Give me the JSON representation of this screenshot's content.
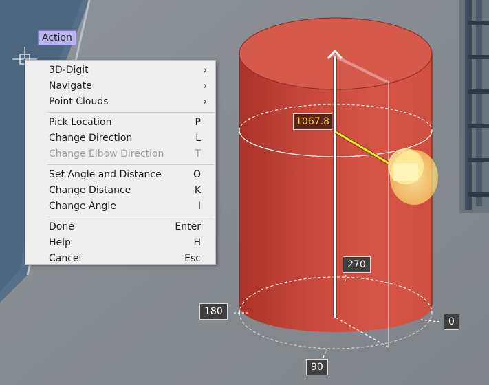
{
  "action_tag": "Action",
  "distance_label": "1067.8",
  "angle_labels": {
    "deg_0": "0",
    "deg_90": "90",
    "deg_180": "180",
    "deg_270": "270"
  },
  "menu": {
    "groups": [
      [
        {
          "label": "3D-Digit",
          "submenu": true,
          "name": "menu-item-3d-digit"
        },
        {
          "label": "Navigate",
          "submenu": true,
          "name": "menu-item-navigate"
        },
        {
          "label": "Point Clouds",
          "submenu": true,
          "name": "menu-item-point-clouds"
        }
      ],
      [
        {
          "label": "Pick Location",
          "key": "P",
          "name": "menu-item-pick-location"
        },
        {
          "label": "Change Direction",
          "key": "L",
          "name": "menu-item-change-direction"
        },
        {
          "label": "Change Elbow Direction",
          "key": "T",
          "disabled": true,
          "name": "menu-item-change-elbow-direction"
        }
      ],
      [
        {
          "label": "Set Angle and Distance",
          "key": "O",
          "name": "menu-item-set-angle-and-distance"
        },
        {
          "label": "Change Distance",
          "key": "K",
          "name": "menu-item-change-distance"
        },
        {
          "label": "Change Angle",
          "key": "I",
          "name": "menu-item-change-angle"
        }
      ],
      [
        {
          "label": "Done",
          "key": "Enter",
          "name": "menu-item-done"
        },
        {
          "label": "Help",
          "key": "H",
          "name": "menu-item-help"
        },
        {
          "label": "Cancel",
          "key": "Esc",
          "name": "menu-item-cancel"
        }
      ]
    ]
  },
  "colors": {
    "cylinder": "#d5493a",
    "cylinder_top": "#d8604f",
    "highlight": "#ffe97a",
    "menu_bg": "#efefef"
  }
}
